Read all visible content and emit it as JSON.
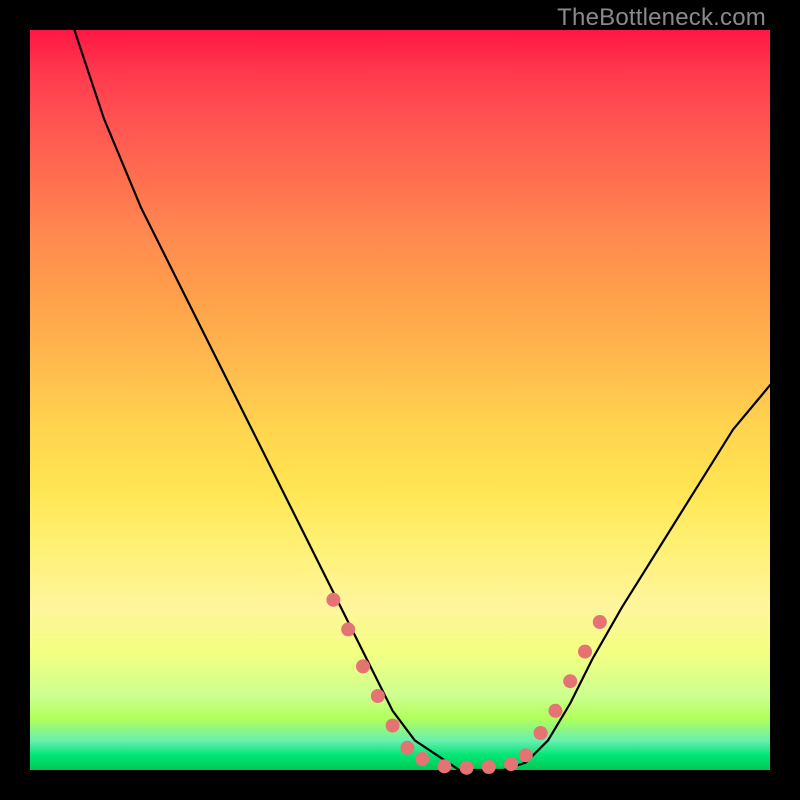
{
  "watermark": "TheBottleneck.com",
  "colors": {
    "frame": "#000000",
    "curve_stroke": "#000000",
    "marker_fill": "#e57373",
    "marker_stroke": "#e57373"
  },
  "chart_data": {
    "type": "line",
    "title": "",
    "xlabel": "",
    "ylabel": "",
    "xlim": [
      0,
      100
    ],
    "ylim": [
      0,
      100
    ],
    "grid": false,
    "series": [
      {
        "name": "curve",
        "x": [
          6,
          10,
          15,
          20,
          25,
          30,
          35,
          40,
          43,
          46,
          49,
          52,
          55,
          58,
          61,
          64,
          67,
          70,
          73,
          76,
          80,
          85,
          90,
          95,
          100
        ],
        "values": [
          100,
          88,
          76,
          66,
          56,
          46,
          36,
          26,
          20,
          14,
          8,
          4,
          2,
          0,
          0,
          0,
          1,
          4,
          9,
          15,
          22,
          30,
          38,
          46,
          52
        ]
      }
    ],
    "markers": [
      {
        "x": 41,
        "y": 23
      },
      {
        "x": 43,
        "y": 19
      },
      {
        "x": 45,
        "y": 14
      },
      {
        "x": 47,
        "y": 10
      },
      {
        "x": 49,
        "y": 6
      },
      {
        "x": 51,
        "y": 3
      },
      {
        "x": 53,
        "y": 1.5
      },
      {
        "x": 56,
        "y": 0.5
      },
      {
        "x": 59,
        "y": 0.3
      },
      {
        "x": 62,
        "y": 0.4
      },
      {
        "x": 65,
        "y": 0.8
      },
      {
        "x": 67,
        "y": 2
      },
      {
        "x": 69,
        "y": 5
      },
      {
        "x": 71,
        "y": 8
      },
      {
        "x": 73,
        "y": 12
      },
      {
        "x": 75,
        "y": 16
      },
      {
        "x": 77,
        "y": 20
      }
    ]
  }
}
